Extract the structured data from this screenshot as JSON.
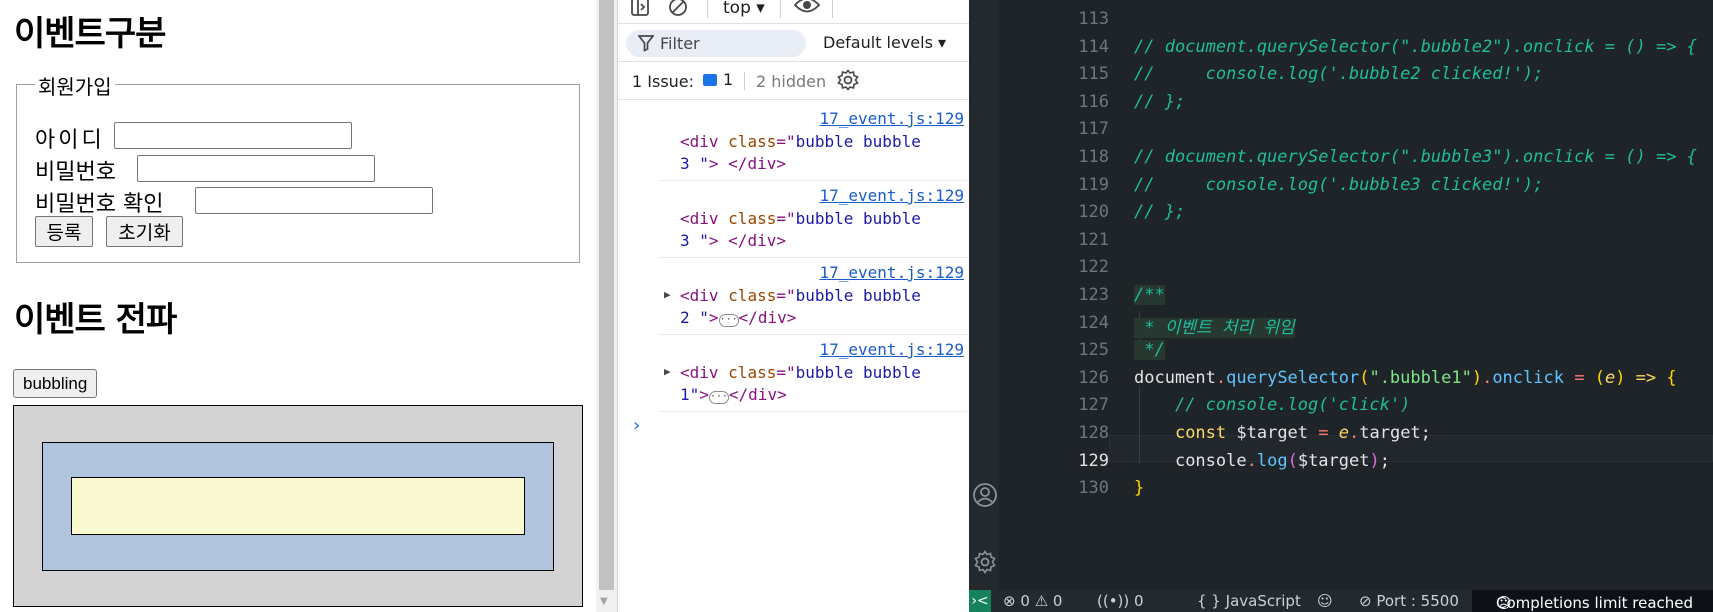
{
  "page": {
    "title_events": "이벤트구분",
    "form": {
      "legend": "회원가입",
      "id_label": "아이디",
      "pw_label": "비밀번호",
      "pw_confirm_label": "비밀번호 확인",
      "id_value": "",
      "pw_value": "",
      "pw_confirm_value": "",
      "submit_label": "등록",
      "reset_label": "초기화"
    },
    "title_propagation": "이벤트 전파",
    "bubbling_button": "bubbling",
    "colors": {
      "bubble1": "#d3d3d3",
      "bubble2": "#b0c4de",
      "bubble3": "#fafad2"
    }
  },
  "devtools": {
    "context": "top",
    "filter_placeholder": "Filter",
    "levels": "Default levels",
    "issues_label": "1 Issue:",
    "issues_count": "1",
    "hidden": "2 hidden",
    "logs": [
      {
        "source": "17_event.js:129",
        "line1": [
          "<div ",
          "class",
          "=\"",
          "bubble bubble"
        ],
        "line2": [
          "3 \"",
          "> </div>"
        ],
        "expandable": false
      },
      {
        "source": "17_event.js:129",
        "line1": [
          "<div ",
          "class",
          "=\"",
          "bubble bubble"
        ],
        "line2": [
          "3 \"",
          "> </div>"
        ],
        "expandable": false
      },
      {
        "source": "17_event.js:129",
        "line1": [
          "<div ",
          "class",
          "=\"",
          "bubble bubble"
        ],
        "line2": [
          "2 \"",
          "></div>"
        ],
        "expandable": true
      },
      {
        "source": "17_event.js:129",
        "line1": [
          "<div ",
          "class",
          "=\"",
          "bubble bubble"
        ],
        "line2": [
          "1\"",
          "></div>"
        ],
        "expandable": true
      }
    ],
    "ellipsis": "···",
    "prompt": "›"
  },
  "editor": {
    "lines": [
      {
        "n": "113",
        "code": ""
      },
      {
        "n": "114",
        "code": "// document.querySelector(\".bubble2\").onclick = () => {"
      },
      {
        "n": "115",
        "code": "//     console.log('.bubble2 clicked!');"
      },
      {
        "n": "116",
        "code": "// };"
      },
      {
        "n": "117",
        "code": ""
      },
      {
        "n": "118",
        "code": "// document.querySelector(\".bubble3\").onclick = () => {"
      },
      {
        "n": "119",
        "code": "//     console.log('.bubble3 clicked!');"
      },
      {
        "n": "120",
        "code": "// };"
      },
      {
        "n": "121",
        "code": ""
      },
      {
        "n": "122",
        "code": ""
      },
      {
        "n": "123",
        "code": "/**"
      },
      {
        "n": "124",
        "code": " * 이벤트 처리 위임"
      },
      {
        "n": "125",
        "code": " */"
      },
      {
        "n": "126",
        "code": "document.querySelector(\".bubble1\").onclick = (e) => {"
      },
      {
        "n": "127",
        "code": "    // console.log('click')"
      },
      {
        "n": "128",
        "code": "    const $target = e.target;"
      },
      {
        "n": "129",
        "code": "    console.log($target);"
      },
      {
        "n": "130",
        "code": "}"
      }
    ],
    "tokens": {
      "document": "document",
      "dot": ".",
      "qs": "querySelector",
      "lparen": "(",
      "sel": "\".bubble1\"",
      "rparen": ")",
      "onclick": "onclick",
      "eq": " = ",
      "param": "e",
      "arrow": " => ",
      "lbrace": "{",
      "comment127": "// console.log('click')",
      "const": "const ",
      "tvar": "$target",
      "target": "target",
      "semi": ";",
      "console": "console",
      "log": "log",
      "rbrace": "}"
    },
    "status": {
      "remote": "›<",
      "errors": "0",
      "warnings": "0",
      "ports": "0",
      "language": "JavaScript",
      "port": "Port : 5500",
      "completions": "Completions limit reached"
    }
  }
}
